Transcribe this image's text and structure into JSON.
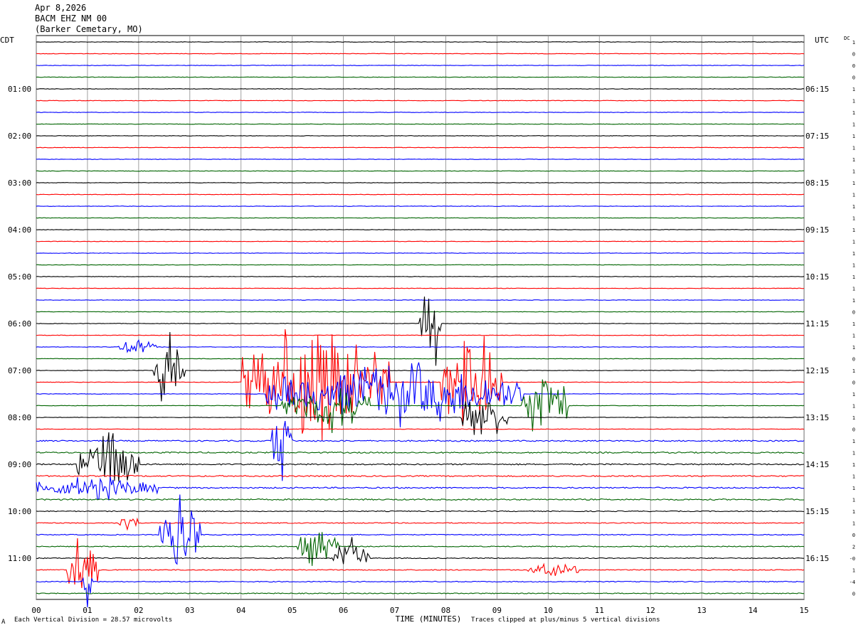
{
  "header": {
    "date": "Apr 8,2026",
    "station": "BACM EHZ NM 00",
    "location": "(Barker Cemetary, MO)"
  },
  "footer": {
    "scale_note": "Each Vertical Division =   28.57 microvolts",
    "clip_note": "Traces clipped at plus/minus 5 vertical divisions",
    "corner_mark": "A"
  },
  "chart_data": {
    "type": "line",
    "title": "",
    "xlabel": "TIME (MINUTES)",
    "ylabel_left": "CDT",
    "ylabel_right": "UTC",
    "dc_label": "DC",
    "x_ticks": [
      "00",
      "01",
      "02",
      "03",
      "04",
      "05",
      "06",
      "07",
      "08",
      "09",
      "10",
      "11",
      "12",
      "13",
      "14",
      "15"
    ],
    "xlim": [
      0,
      15
    ],
    "left_hour_labels": [
      "01:00",
      "02:00",
      "03:00",
      "04:00",
      "05:00",
      "06:00",
      "07:00",
      "08:00",
      "09:00",
      "10:00",
      "11:00"
    ],
    "right_hour_labels": [
      "06:15",
      "07:15",
      "08:15",
      "09:15",
      "10:15",
      "11:15",
      "12:15",
      "13:15",
      "14:15",
      "15:15",
      "16:15"
    ],
    "trace_count": 48,
    "color_cycle": [
      "#000000",
      "#ff0000",
      "#0000ff",
      "#006400"
    ],
    "dc_offsets": [
      "1",
      "0",
      "0",
      "0",
      "1",
      "1",
      "1",
      "1",
      "1",
      "1",
      "1",
      "1",
      "1",
      "1",
      "1",
      "1",
      "1",
      "1",
      "1",
      "1",
      "1",
      "1",
      "1",
      "0",
      "1",
      "1",
      "1",
      "0",
      "1",
      "0",
      "1",
      "1",
      "1",
      "0",
      "1",
      "1",
      "1",
      "1",
      "1",
      "1",
      "1",
      "1",
      "0",
      "2",
      "-0",
      "1",
      "-4",
      "0"
    ],
    "events": [
      {
        "trace": 24,
        "minute_start": 7.5,
        "minute_end": 7.9,
        "amp": 4.5
      },
      {
        "trace": 26,
        "minute_start": 1.6,
        "minute_end": 2.4,
        "amp": 0.6
      },
      {
        "trace": 28,
        "minute_start": 2.3,
        "minute_end": 2.9,
        "amp": 3.5
      },
      {
        "trace": 29,
        "minute_start": 4.0,
        "minute_end": 6.9,
        "amp": 5
      },
      {
        "trace": 29,
        "minute_start": 7.9,
        "minute_end": 9.1,
        "amp": 5
      },
      {
        "trace": 30,
        "minute_start": 4.5,
        "minute_end": 9.5,
        "amp": 2.5
      },
      {
        "trace": 31,
        "minute_start": 4.8,
        "minute_end": 6.5,
        "amp": 2.0
      },
      {
        "trace": 31,
        "minute_start": 9.5,
        "minute_end": 10.4,
        "amp": 4.0
      },
      {
        "trace": 32,
        "minute_start": 8.3,
        "minute_end": 9.2,
        "amp": 2.0
      },
      {
        "trace": 34,
        "minute_start": 4.6,
        "minute_end": 5.0,
        "amp": 4
      },
      {
        "trace": 36,
        "minute_start": 0.8,
        "minute_end": 2.0,
        "amp": 2.5
      },
      {
        "trace": 38,
        "minute_start": 0.0,
        "minute_end": 2.4,
        "amp": 0.9
      },
      {
        "trace": 41,
        "minute_start": 1.6,
        "minute_end": 2.0,
        "amp": 0.8
      },
      {
        "trace": 42,
        "minute_start": 2.4,
        "minute_end": 3.2,
        "amp": 3.5
      },
      {
        "trace": 43,
        "minute_start": 5.1,
        "minute_end": 5.9,
        "amp": 1.6
      },
      {
        "trace": 44,
        "minute_start": 5.8,
        "minute_end": 6.5,
        "amp": 1.9
      },
      {
        "trace": 45,
        "minute_start": 0.6,
        "minute_end": 1.2,
        "amp": 3.5
      },
      {
        "trace": 45,
        "minute_start": 9.6,
        "minute_end": 10.6,
        "amp": 0.6
      },
      {
        "trace": 46,
        "minute_start": 0.9,
        "minute_end": 1.1,
        "amp": 2.0
      }
    ]
  }
}
